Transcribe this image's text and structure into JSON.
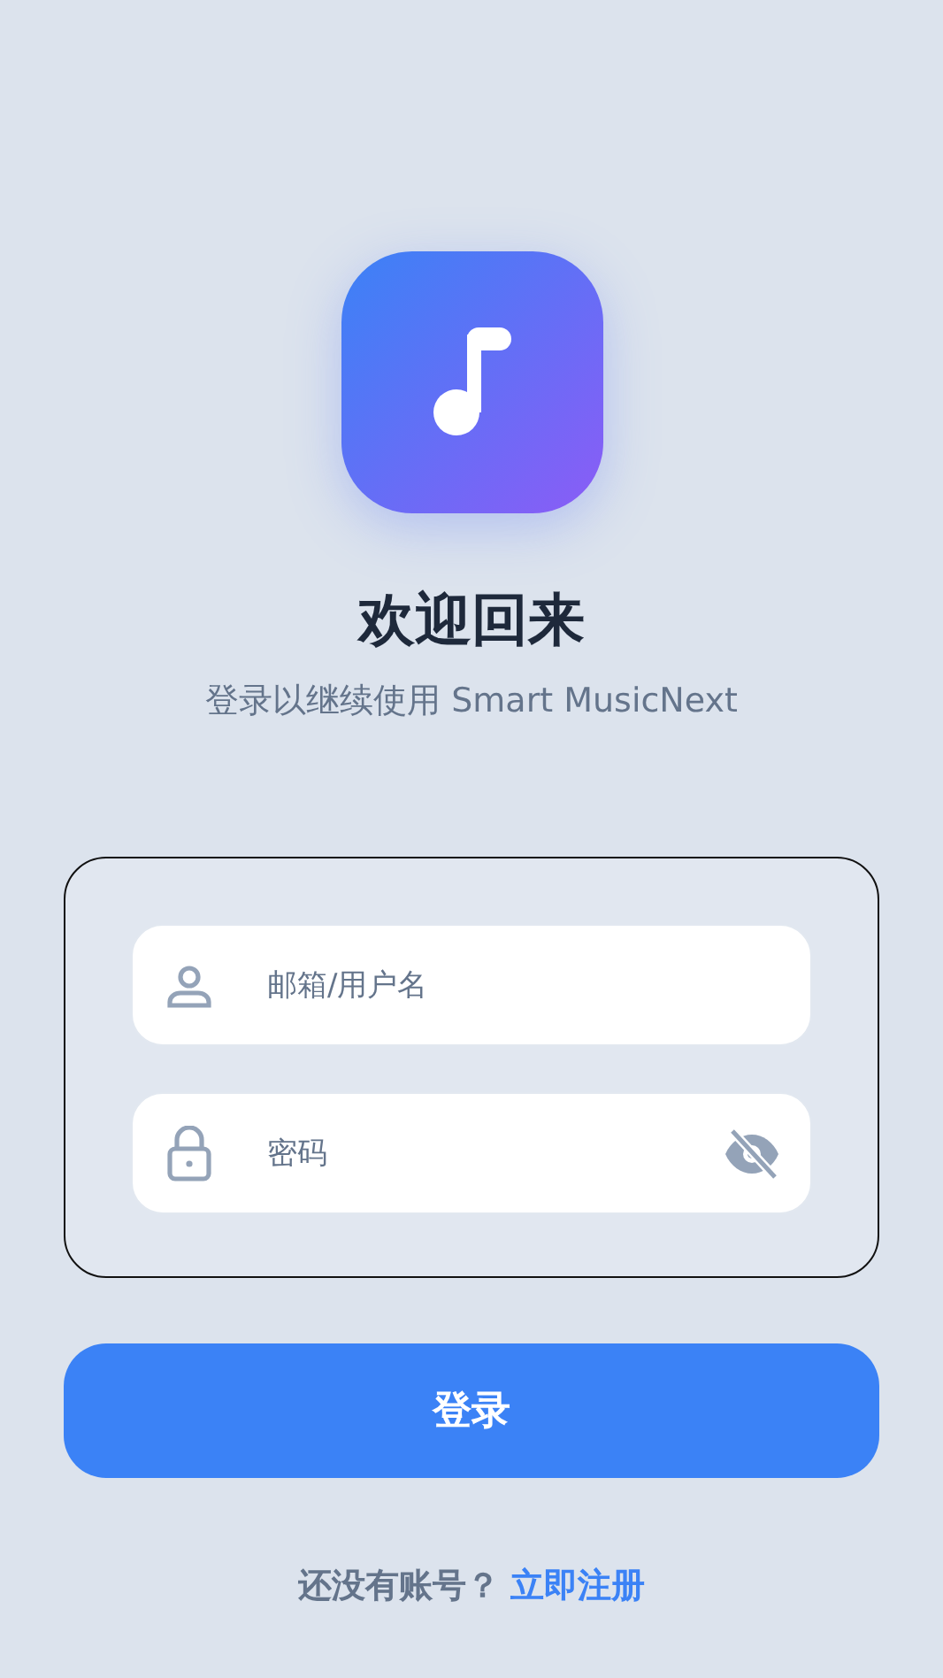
{
  "title": "欢迎回来",
  "subtitle": "登录以继续使用 Smart MusicNext",
  "fields": [
    {
      "kind": "user",
      "placeholder": "邮箱/用户名"
    },
    {
      "kind": "password",
      "placeholder": "密码"
    }
  ],
  "login_button": "登录",
  "footer": {
    "prompt": "还没有账号？",
    "link": "立即注册"
  }
}
